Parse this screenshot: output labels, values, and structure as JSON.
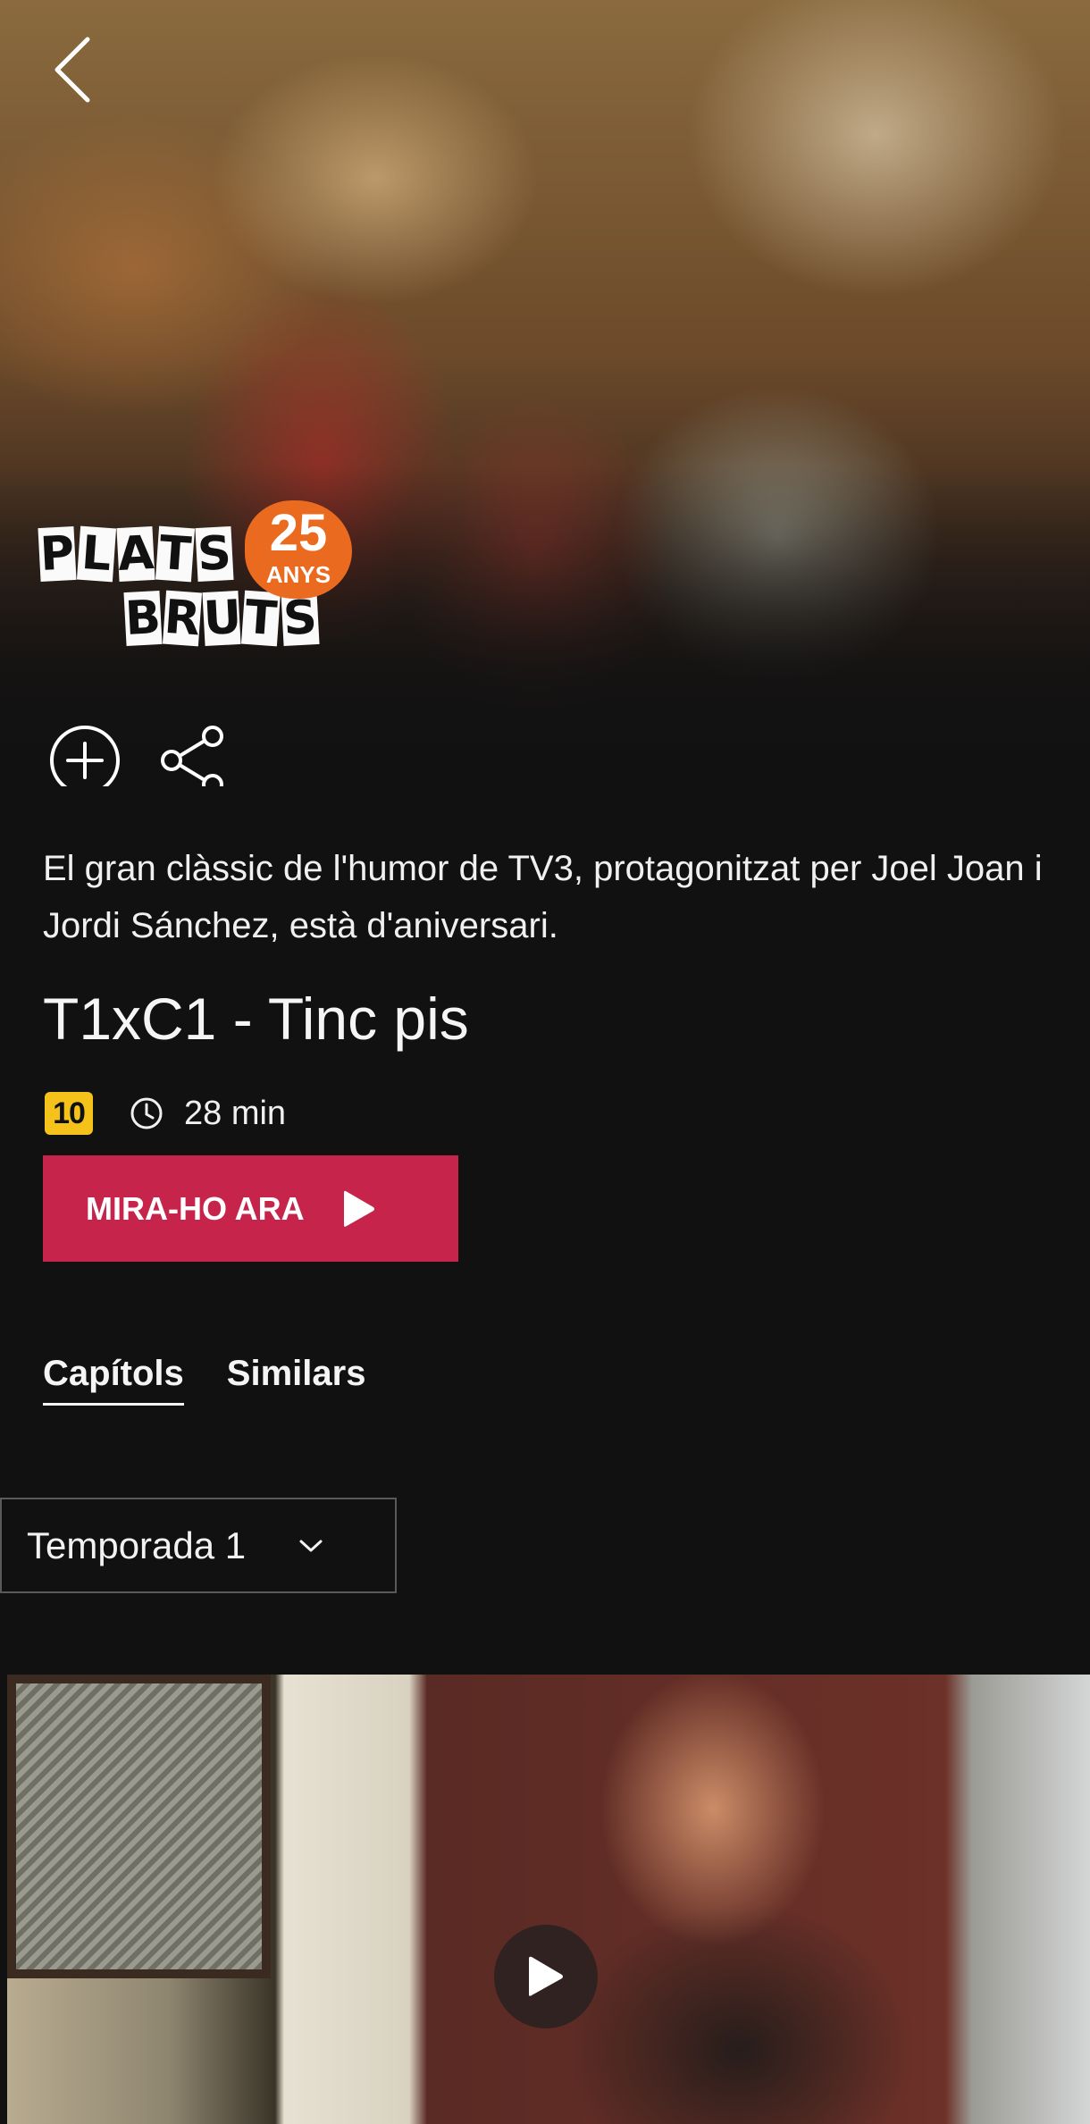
{
  "hero": {
    "image_description_icon": "cast-photo",
    "back_icon": "chevron-left-icon"
  },
  "logo": {
    "word1": [
      "P",
      "L",
      "A",
      "T",
      "S"
    ],
    "word2": [
      "B",
      "R",
      "U",
      "T",
      "S"
    ],
    "anniversary_number": "25",
    "anniversary_label": "ANYS"
  },
  "actions": {
    "add_icon": "plus-circle-icon",
    "share_icon": "share-icon"
  },
  "program": {
    "description": "El gran clàssic de l'humor de TV3, protagonitzat per Joel Joan i Jordi Sánchez, està d'aniversari.",
    "episode_title": "T1xC1 - Tinc pis",
    "age_rating": "10",
    "duration": "28 min"
  },
  "watch_button": {
    "label": "MIRA-HO ARA"
  },
  "tabs": [
    {
      "label": "Capítols",
      "active": true
    },
    {
      "label": "Similars",
      "active": false
    }
  ],
  "season_selector": {
    "selected": "Temporada 1"
  },
  "colors": {
    "background": "#111112",
    "accent": "#c6244b",
    "rating_badge": "#f4c21b"
  }
}
